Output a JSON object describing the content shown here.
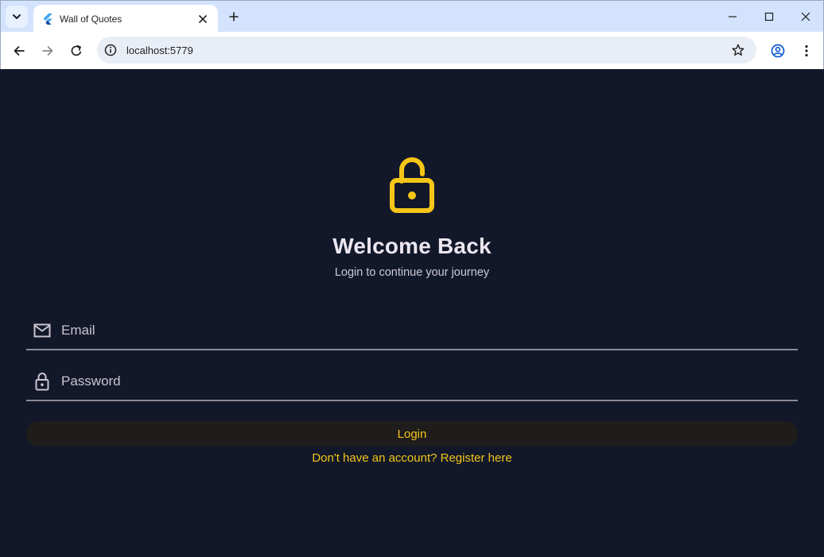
{
  "browser": {
    "tab_title": "Wall of Quotes",
    "url": "localhost:5779"
  },
  "page": {
    "heading": "Welcome Back",
    "subheading": "Login to continue your journey",
    "email_placeholder": "Email",
    "password_placeholder": "Password",
    "login_label": "Login",
    "register_link": "Don't have an account? Register here"
  },
  "colors": {
    "background": "#121829",
    "accent": "#f5c518",
    "text": "#ece6f0"
  },
  "icons": {
    "hero": "lock-open-icon",
    "email": "mail-icon",
    "password": "lock-icon"
  }
}
